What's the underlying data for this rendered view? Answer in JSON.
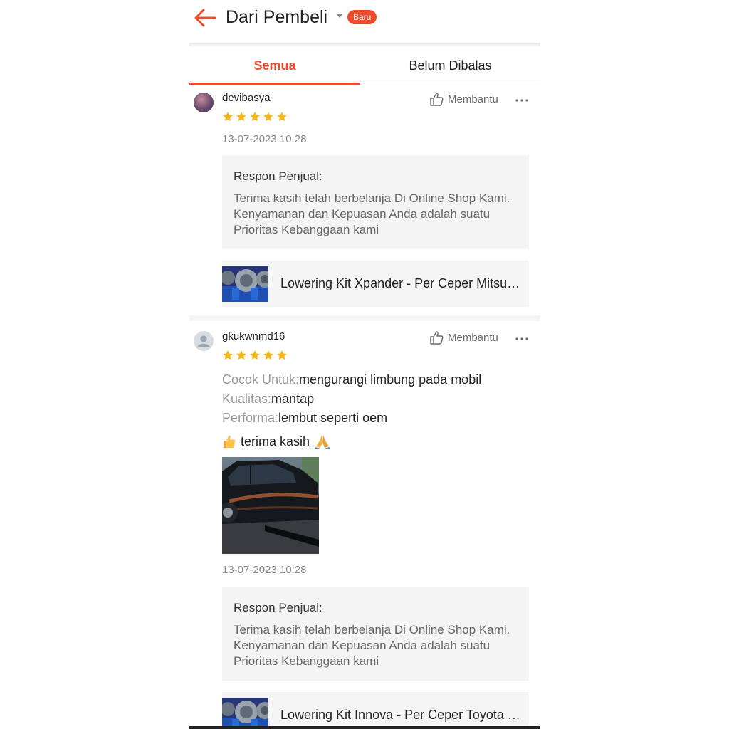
{
  "header": {
    "title": "Dari Pembeli",
    "badge": "Baru"
  },
  "tabs": [
    {
      "label": "Semua",
      "active": true
    },
    {
      "label": "Belum Dibalas",
      "active": false
    }
  ],
  "colors": {
    "accent": "#ee4d2d",
    "star": "#f6b818",
    "response_bg": "#f4f4f4"
  },
  "reviews": [
    {
      "username": "devibasya",
      "helpful_label": "Membantu",
      "rating": 5,
      "date": "13-07-2023 10:28",
      "response_label": "Respon Penjual:",
      "response_text": "Terima kasih telah berbelanja Di Online Shop Kami. Kenyamanan dan Kepuasan Anda adalah suatu Prioritas Kebanggaan kami",
      "product_name": "Lowering Kit Xpander - Per Ceper Mitsubishi Xpander"
    },
    {
      "username": "gkukwnmd16",
      "helpful_label": "Membantu",
      "rating": 5,
      "attributes": [
        {
          "key": "Cocok Untuk:",
          "value": "mengurangi limbung pada mobil"
        },
        {
          "key": "Kualitas:",
          "value": "mantap"
        },
        {
          "key": "Performa:",
          "value": "lembut seperti oem"
        }
      ],
      "comment": "terima kasih",
      "date": "13-07-2023 10:28",
      "response_label": "Respon Penjual:",
      "response_text": "Terima kasih telah berbelanja Di Online Shop Kami. Kenyamanan dan Kepuasan Anda adalah suatu Prioritas Kebanggaan kami",
      "product_name": "Lowering Kit Innova - Per Ceper Toyota Innova"
    }
  ]
}
